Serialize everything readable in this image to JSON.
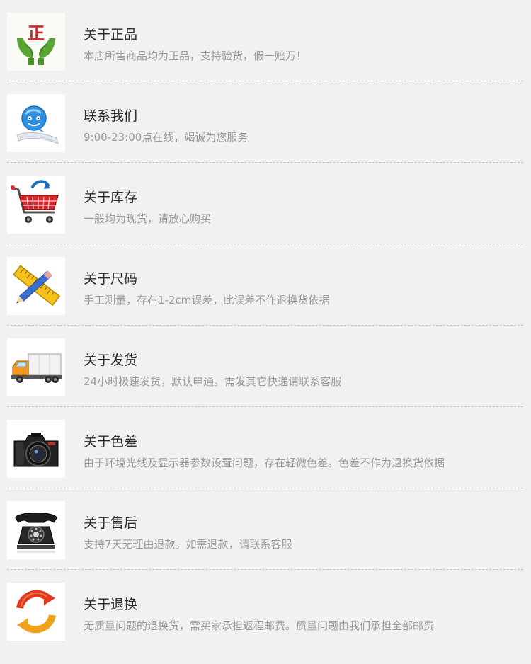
{
  "items": [
    {
      "icon": "genuine-hands-icon",
      "title": "关于正品",
      "desc": "本店所售商品均为正品，支持验货，假一赔万！"
    },
    {
      "icon": "chat-bubble-icon",
      "title": "联系我们",
      "desc": "9:00-23:00点在线，竭诚为您服务"
    },
    {
      "icon": "shopping-cart-icon",
      "title": "关于库存",
      "desc": "一般均为现货，请放心购买"
    },
    {
      "icon": "ruler-pencil-icon",
      "title": "关于尺码",
      "desc": "手工测量，存在1-2cm误差，此误差不作退换货依据"
    },
    {
      "icon": "delivery-truck-icon",
      "title": "关于发货",
      "desc": "24小时极速发货，默认申通。需发其它快递请联系客服"
    },
    {
      "icon": "camera-icon",
      "title": "关于色差",
      "desc": "由于环境光线及显示器参数设置问题，存在轻微色差。色差不作为退换货依据"
    },
    {
      "icon": "telephone-icon",
      "title": "关于售后",
      "desc": "支持7天无理由退款。如需退款，请联系客服"
    },
    {
      "icon": "exchange-arrows-icon",
      "title": "关于退换",
      "desc": "无质量问题的退换货，需买家承担返程邮费。质量问题由我们承担全部邮费"
    }
  ],
  "icon_glyphs": {
    "genuine_text": "正"
  }
}
